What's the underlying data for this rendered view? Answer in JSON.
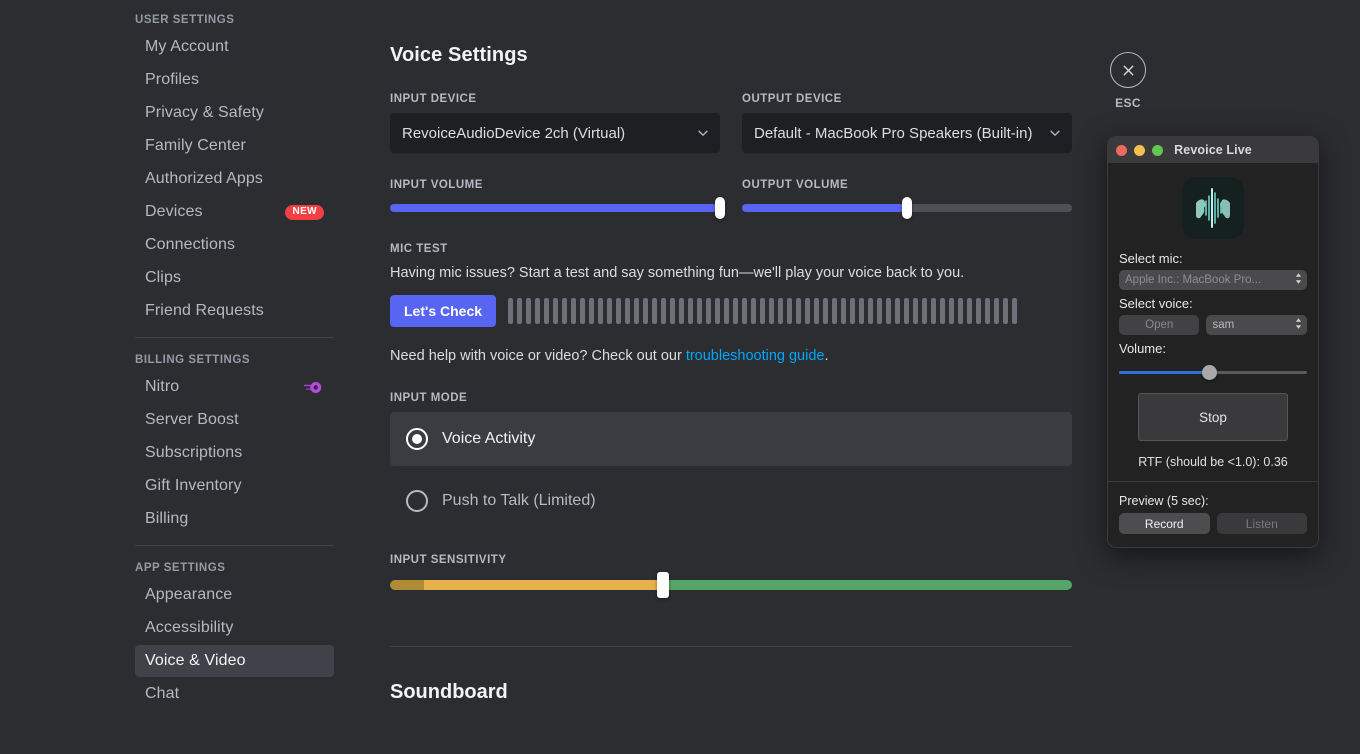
{
  "sidebar": {
    "groups": [
      {
        "header": "USER SETTINGS",
        "items": [
          {
            "label": "My Account"
          },
          {
            "label": "Profiles"
          },
          {
            "label": "Privacy & Safety"
          },
          {
            "label": "Family Center"
          },
          {
            "label": "Authorized Apps"
          },
          {
            "label": "Devices",
            "badge": "NEW"
          },
          {
            "label": "Connections"
          },
          {
            "label": "Clips"
          },
          {
            "label": "Friend Requests"
          }
        ]
      },
      {
        "header": "BILLING SETTINGS",
        "items": [
          {
            "label": "Nitro",
            "icon": "nitro-icon"
          },
          {
            "label": "Server Boost"
          },
          {
            "label": "Subscriptions"
          },
          {
            "label": "Gift Inventory"
          },
          {
            "label": "Billing"
          }
        ]
      },
      {
        "header": "APP SETTINGS",
        "items": [
          {
            "label": "Appearance"
          },
          {
            "label": "Accessibility"
          },
          {
            "label": "Voice & Video",
            "active": true
          },
          {
            "label": "Chat"
          }
        ]
      }
    ]
  },
  "main": {
    "page_title": "Voice Settings",
    "input_device": {
      "label": "INPUT DEVICE",
      "value": "RevoiceAudioDevice 2ch (Virtual)",
      "icon": "chevron-down-icon"
    },
    "output_device": {
      "label": "OUTPUT DEVICE",
      "value": "Default - MacBook Pro Speakers (Built-in)",
      "icon": "chevron-down-icon"
    },
    "input_volume": {
      "label": "INPUT VOLUME",
      "percent": 100
    },
    "output_volume": {
      "label": "OUTPUT VOLUME",
      "percent": 50
    },
    "mic_test": {
      "label": "MIC TEST",
      "description": "Having mic issues? Start a test and say something fun—we'll play your voice back to you.",
      "button": "Let's Check",
      "bars": 57
    },
    "help": {
      "prefix": "Need help with voice or video? Check out our ",
      "link": "troubleshooting guide",
      "suffix": "."
    },
    "input_mode": {
      "label": "INPUT MODE",
      "options": [
        {
          "label": "Voice Activity",
          "selected": true
        },
        {
          "label": "Push to Talk (Limited)",
          "selected": false
        }
      ]
    },
    "input_sensitivity": {
      "label": "INPUT SENSITIVITY",
      "percent": 40,
      "colors": {
        "low": "#b08a34",
        "mid": "#e6b04a",
        "high": "#55a567"
      }
    },
    "soundboard_title": "Soundboard"
  },
  "esc": {
    "label": "ESC",
    "icon": "close-icon"
  },
  "revoice": {
    "title": "Revoice Live",
    "traffic_lights": [
      "#ed6a5e",
      "#f5bf4f",
      "#61c554"
    ],
    "app_icon": "revoice-waveform-icon",
    "select_mic": {
      "label": "Select mic:",
      "value": "Apple Inc.: MacBook Pro..."
    },
    "select_voice": {
      "label": "Select voice:",
      "open_button": "Open",
      "value": "sam"
    },
    "volume": {
      "label": "Volume:",
      "percent": 48
    },
    "stop_button": "Stop",
    "rtf": "RTF (should be <1.0): 0.36",
    "preview": {
      "label": "Preview (5 sec):",
      "record": "Record",
      "listen": "Listen"
    }
  }
}
